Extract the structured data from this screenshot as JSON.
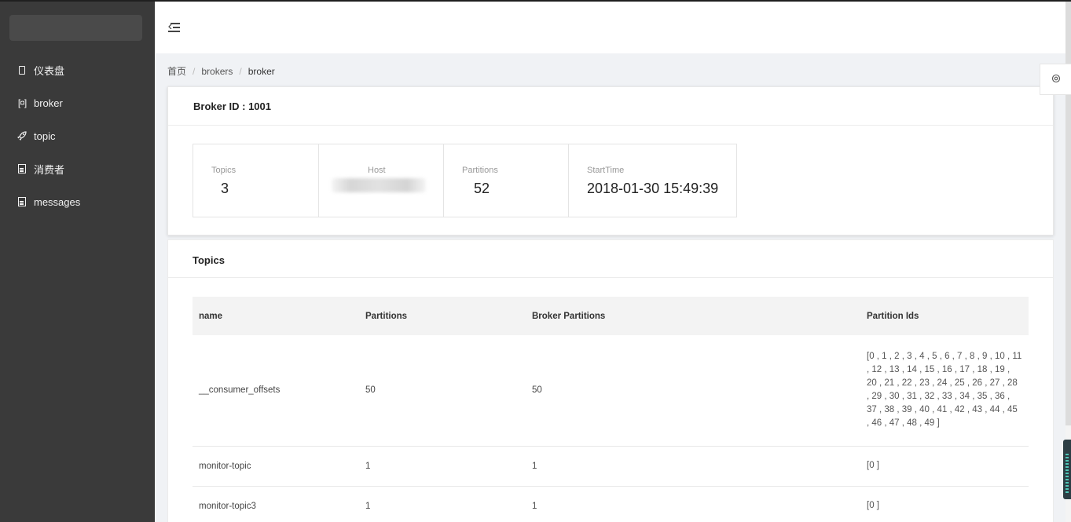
{
  "sidebar": {
    "items": [
      {
        "label": "仪表盘",
        "icon": "tablet-icon"
      },
      {
        "label": "broker",
        "icon": "scan-icon"
      },
      {
        "label": "topic",
        "icon": "rocket-icon"
      },
      {
        "label": "消费者",
        "icon": "file-icon"
      },
      {
        "label": "messages",
        "icon": "file-icon"
      }
    ]
  },
  "breadcrumb": {
    "home": "首页",
    "sep": "/",
    "brokers": "brokers",
    "broker": "broker"
  },
  "broker": {
    "title": "Broker ID : 1001",
    "stats": {
      "topics_label": "Topics",
      "topics_value": "3",
      "host_label": "Host",
      "partitions_label": "Partitions",
      "partitions_value": "52",
      "starttime_label": "StartTime",
      "starttime_value": "2018-01-30 15:49:39"
    }
  },
  "topics": {
    "title": "Topics",
    "columns": [
      "name",
      "Partitions",
      "Broker Partitions",
      "Partition Ids"
    ],
    "rows": [
      {
        "name": "__consumer_offsets",
        "partitions": "50",
        "broker_partitions": "50",
        "ids": "[0 , 1 , 2 , 3 , 4 , 5 , 6 , 7 , 8 , 9 , 10 , 11 , 12 , 13 , 14 , 15 , 16 , 17 , 18 , 19 , 20 , 21 , 22 , 23 , 24 , 25 , 26 , 27 , 28 , 29 , 30 , 31 , 32 , 33 , 34 , 35 , 36 , 37 , 38 , 39 , 40 , 41 , 42 , 43 , 44 , 45 , 46 , 47 , 48 , 49 ]"
      },
      {
        "name": "monitor-topic",
        "partitions": "1",
        "broker_partitions": "1",
        "ids": "[0 ]"
      },
      {
        "name": "monitor-topic3",
        "partitions": "1",
        "broker_partitions": "1",
        "ids": "[0 ]"
      }
    ]
  },
  "colors": {
    "sidebar_bg": "#3a3a3a",
    "page_bg": "#f0f2f5",
    "card_bg": "#ffffff"
  }
}
